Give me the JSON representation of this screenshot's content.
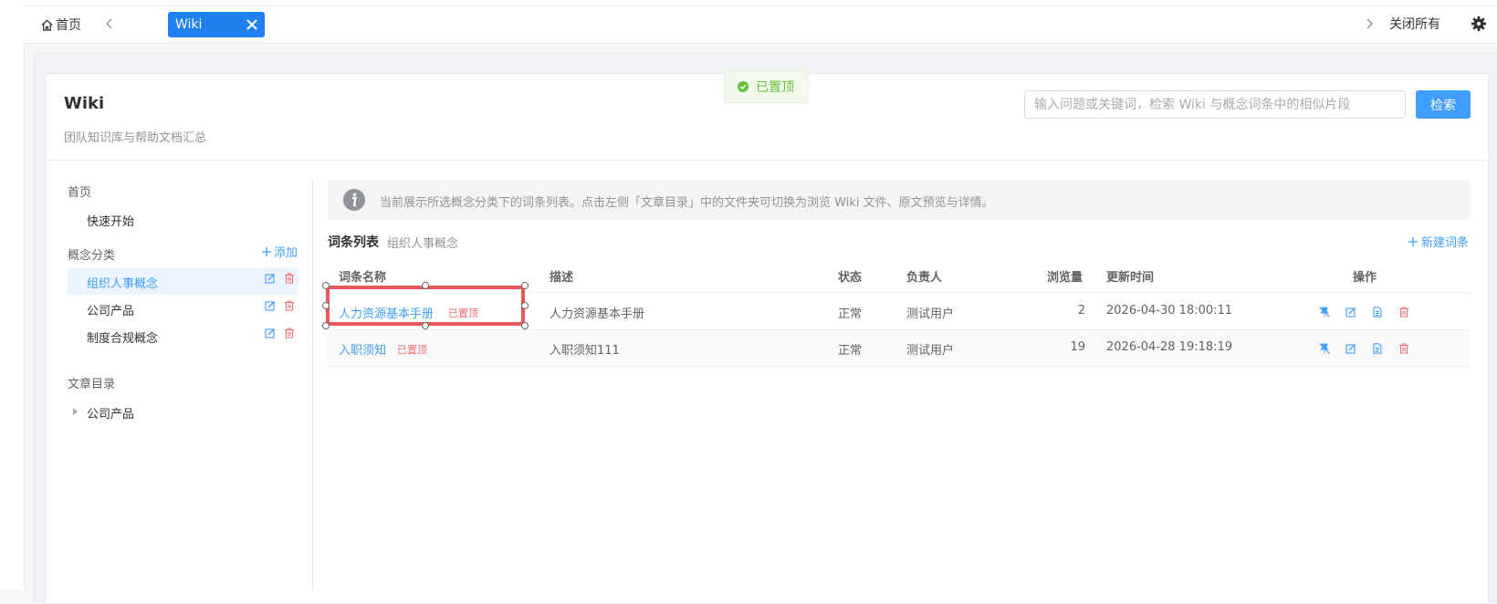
{
  "tabs": {
    "home_label": "首页",
    "wiki_label": "Wiki",
    "close_all_label": "关闭所有"
  },
  "toast": {
    "text": "已置顶"
  },
  "header": {
    "title": "Wiki",
    "subtitle": "团队知识库与帮助文档汇总",
    "search_placeholder": "输入问题或关键词，检索 Wiki 与概念词条中的相似片段",
    "search_button": "检索"
  },
  "sidebar": {
    "home_label": "首页",
    "quick_start": "快速开始",
    "categories_label": "概念分类",
    "add_label": "添加",
    "categories": [
      {
        "label": "组织人事概念",
        "selected": true
      },
      {
        "label": "公司产品",
        "selected": false
      },
      {
        "label": "制度合规概念",
        "selected": false
      }
    ],
    "articles_label": "文章目录",
    "articles": [
      {
        "label": "公司产品"
      }
    ]
  },
  "info": {
    "text": "当前展示所选概念分类下的词条列表。点击左侧「文章目录」中的文件夹可切换为浏览 Wiki 文件、原文预览与详情。"
  },
  "list": {
    "title": "词条列表",
    "category": "组织人事概念",
    "new_label": "新建词条",
    "columns": [
      "词条名称",
      "描述",
      "状态",
      "负责人",
      "浏览量",
      "更新时间",
      "操作"
    ],
    "rows": [
      {
        "name": "人力资源基本手册",
        "badge": "已置顶",
        "desc": "人力资源基本手册",
        "status": "正常",
        "owner": "测试用户",
        "views": "2",
        "updated": "2026-04-30 18:00:11"
      },
      {
        "name": "入职须知",
        "badge": "已置顶",
        "desc": "入职须知111",
        "status": "正常",
        "owner": "测试用户",
        "views": "19",
        "updated": "2026-04-28 19:18:19"
      }
    ]
  },
  "colors": {
    "primary": "#409eff",
    "tab_active": "#2080f0",
    "danger": "#f56c6c",
    "success": "#67c23a",
    "selection": "#e8595c"
  }
}
